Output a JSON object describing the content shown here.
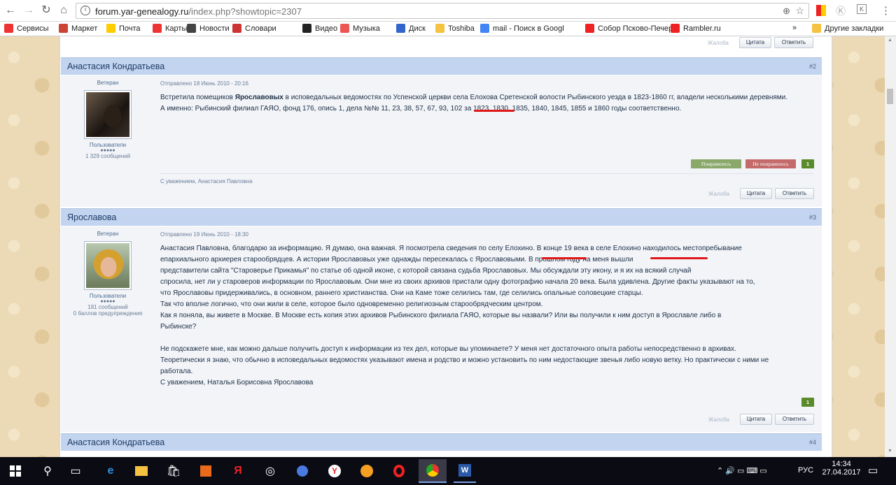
{
  "browser": {
    "url_host": "forum.yar-genealogy.ru",
    "url_path": "/index.php?showtopic=2307",
    "bookmarks": [
      {
        "label": "Сервисы",
        "color": "#e33"
      },
      {
        "label": "Маркет",
        "color": "#c43"
      },
      {
        "label": "Почта",
        "color": "#fc0"
      },
      {
        "label": "Карты",
        "color": "#e33"
      },
      {
        "label": "Новости",
        "color": "#444"
      },
      {
        "label": "Словари",
        "color": "#c33"
      },
      {
        "label": "Видео",
        "color": "#222"
      },
      {
        "label": "Музыка",
        "color": "#e55"
      },
      {
        "label": "Диск",
        "color": "#36c"
      },
      {
        "label": "Toshiba",
        "color": "#f5c242"
      },
      {
        "label": "mail - Поиск в Googl",
        "color": "#4285f4"
      },
      {
        "label": "Собор Псково-Печер",
        "color": "#e22"
      },
      {
        "label": "Rambler.ru",
        "color": "#e22"
      }
    ],
    "bookmarks_more": "»",
    "other_bookmarks": "Другие закладки"
  },
  "forum": {
    "top_actions": {
      "report": "Жалоба",
      "quote": "Цитата",
      "reply": "Ответить"
    },
    "posts": [
      {
        "author": "Анастасия Кондратьева",
        "num": "#2",
        "rank": "Ветеран",
        "group": "Пользователи",
        "dots": "●●●●●",
        "count": "1 329 сообщений",
        "date": "Отправлено 18 Июнь 2010 - 20:16",
        "lines": [
          "Встретила помещиков <b>Ярославовых</b> в исповедальных ведомостях по Успенской церкви села Елохова Сретенской волости Рыбинского уезда в 1823-1860 гг, владели несколькими деревнями.",
          "А именно: Рыбинский филиал ГАЯО, фонд 176, опись 1, дела №№ 11, 23, 38, 57, 67, 93, 102 за 1823, 1830, 1835, 1840, 1845, 1855 и 1860 годы соответственно."
        ],
        "like": "Понравилось",
        "dislike": "Не понравилось",
        "rating": "1",
        "signature": "С уважением, Анастасия Павловна",
        "report": "Жалоба",
        "quote": "Цитата",
        "reply": "Ответить"
      },
      {
        "author": "Ярославова",
        "num": "#3",
        "rank": "Ветеран",
        "group": "Пользователи",
        "dots": "●●●●●",
        "count": "181 сообщений",
        "warn": "0 баллов предупреждения",
        "date": "Отправлено 19 Июнь 2010 - 18:30",
        "lines": [
          "Анастасия  Павловна,  благодарю  за  информацию.  Я  думаю, она  важная.  Я  посмотрела  сведения  по  селу Елохино. В  конце  19 века  в  селе Елохино   находилось местопребывание",
          "епархиального архиерея старообрядцев. А  истории  Ярославовых  уже однажды пересекалась  с Ярославовыми.  В прошлом году на меня вышли",
          "представители сайта \"Староверье Прикамья\"    по    статье об   одной иконе,  с которой связана  судьба Ярославовых.  Мы обсуждали эту икону,  и  я   их  на всякий  случай",
          "спросила,  нет ли у  староверов  информации по  Ярославовым. Они  мне из  своих  архивов  пристали одну  фотографию  начала   20 века.  Была  удивлена.  Другие факты  указывают на то,",
          "что  Ярославовы  придерживались, в основном,   раннего  христианства. Они  на Каме  тоже  селились там, где  селились    опальные  соловецкие  старцы.",
          "Так что вполне   логично, что они жили в   селе, которое  было одновременно  религиозным старообрядческим  центром.",
          "Как  я  поняла, вы живете  в Москве.  В Москве    есть копия  этих    архивов Рыбинского  филиала  ГАЯО, которые  вы  назвали?   Или  вы получили  к ним доступ  в Ярославле  либо в",
          "Рыбинске?",
          "",
          "Не  подскажете мне,  как можно  дальше   получить доступ к информации из  тех  дел,  которые  вы упоминаете? У  меня нет достаточного опыта  работы  непосредственно  в архивах.",
          "Теоретически  я  знаю, что обычно   в исповедальных ведомостях указывают имена и родство и можно  установить по ним недостающие  звенья  либо новую ветку. Но практически с ними не",
          "работала.",
          "С уважением, Наталья Борисовна   Ярославова"
        ],
        "rating": "1",
        "report": "Жалоба",
        "quote": "Цитата",
        "reply": "Ответить"
      }
    ],
    "next_header": {
      "author": "Анастасия Кондратьева",
      "num": "#4"
    }
  },
  "taskbar": {
    "lang": "РУС",
    "time": "14:34",
    "date": "27.04.2017"
  }
}
